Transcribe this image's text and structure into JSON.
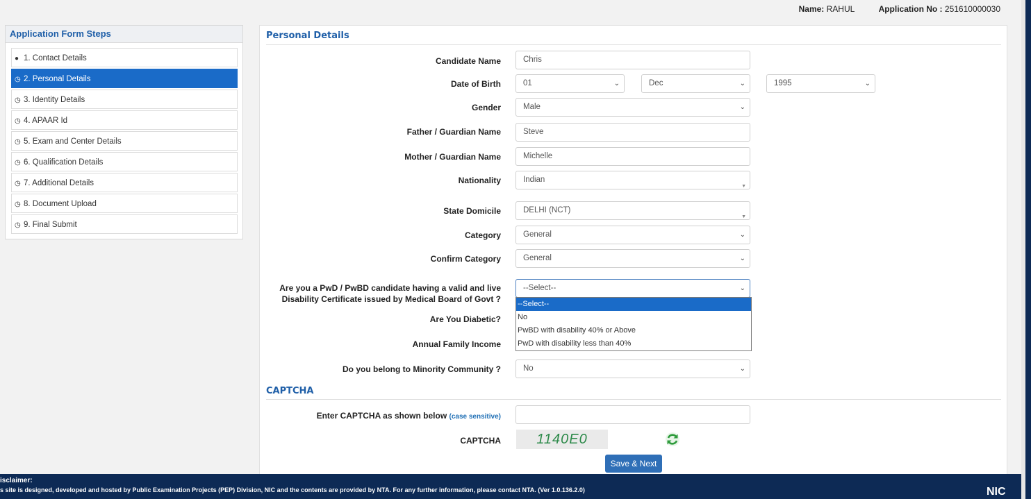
{
  "header": {
    "name_label": "Name:",
    "name_value": "RAHUL",
    "app_label": "Application No :",
    "app_value": "251610000030"
  },
  "steps": {
    "title": "Application Form Steps",
    "items": [
      {
        "label": "1. Contact Details",
        "icon": "check-circle-icon"
      },
      {
        "label": "2. Personal Details",
        "icon": "clock-icon"
      },
      {
        "label": "3. Identity Details",
        "icon": "clock-icon"
      },
      {
        "label": "4. APAAR Id",
        "icon": "clock-icon"
      },
      {
        "label": "5. Exam and Center Details",
        "icon": "clock-icon"
      },
      {
        "label": "6. Qualification Details",
        "icon": "clock-icon"
      },
      {
        "label": "7. Additional Details",
        "icon": "clock-icon"
      },
      {
        "label": "8. Document Upload",
        "icon": "clock-icon"
      },
      {
        "label": "9. Final Submit",
        "icon": "clock-icon"
      }
    ]
  },
  "form": {
    "section_title": "Personal Details",
    "candidate_name": {
      "label": "Candidate Name",
      "value": "Chris"
    },
    "dob": {
      "label": "Date of Birth",
      "day": "01",
      "month": "Dec",
      "year": "1995"
    },
    "gender": {
      "label": "Gender",
      "value": "Male"
    },
    "father": {
      "label": "Father / Guardian Name",
      "value": "Steve"
    },
    "mother": {
      "label": "Mother / Guardian Name",
      "value": "Michelle"
    },
    "nationality": {
      "label": "Nationality",
      "value": "Indian"
    },
    "state": {
      "label": "State Domicile",
      "value": "DELHI (NCT)"
    },
    "category": {
      "label": "Category",
      "value": "General"
    },
    "confirm_category": {
      "label": "Confirm Category",
      "value": "General"
    },
    "pwd": {
      "label_line1": "Are you a PwD / PwBD candidate having a valid and live",
      "label_line2": "Disability Certificate issued by Medical Board of Govt ?",
      "value": "--Select--",
      "options": [
        "--Select--",
        "No",
        "PwBD with disability 40% or Above",
        "PwD with disability less than 40%"
      ]
    },
    "diabetic": {
      "label": "Are You Diabetic?"
    },
    "income": {
      "label": "Annual Family Income"
    },
    "minority": {
      "label": "Do you belong to Minority Community ?",
      "value": "No"
    }
  },
  "captcha": {
    "section_title": "CAPTCHA",
    "enter_label": "Enter CAPTCHA as shown below",
    "case_note": "(case sensitive)",
    "label": "CAPTCHA",
    "image_text": "1140E0",
    "input_value": ""
  },
  "save_button": "Save & Next",
  "footer": {
    "title": "isclaimer:",
    "text": "s site is designed, developed and hosted by Public Examination Projects (PEP) Division, NIC and the contents are provided by NTA. For any further information, please contact NTA. (Ver 1.0.136.2.0)",
    "logo_text": "NIC"
  }
}
